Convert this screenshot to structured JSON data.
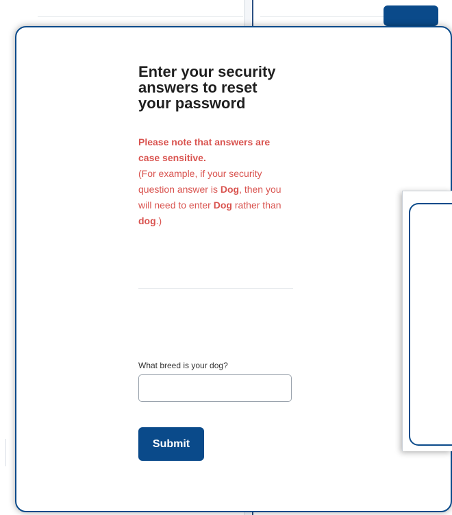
{
  "form": {
    "title": "Enter your security answers to reset your password",
    "note": {
      "heading": "Please note that answers are case sensitive.",
      "t1": "(For example, if your security question answer is ",
      "b1": "Dog",
      "t2": ", then you will need to enter ",
      "b2": "Dog",
      "t3": " rather than ",
      "b3": "dog",
      "t4": ".)"
    },
    "question": "What breed is your dog?",
    "answer_value": "",
    "submit_label": "Submit"
  },
  "colors": {
    "primary": "#0a4a8a",
    "warning_text": "#d9534f"
  }
}
